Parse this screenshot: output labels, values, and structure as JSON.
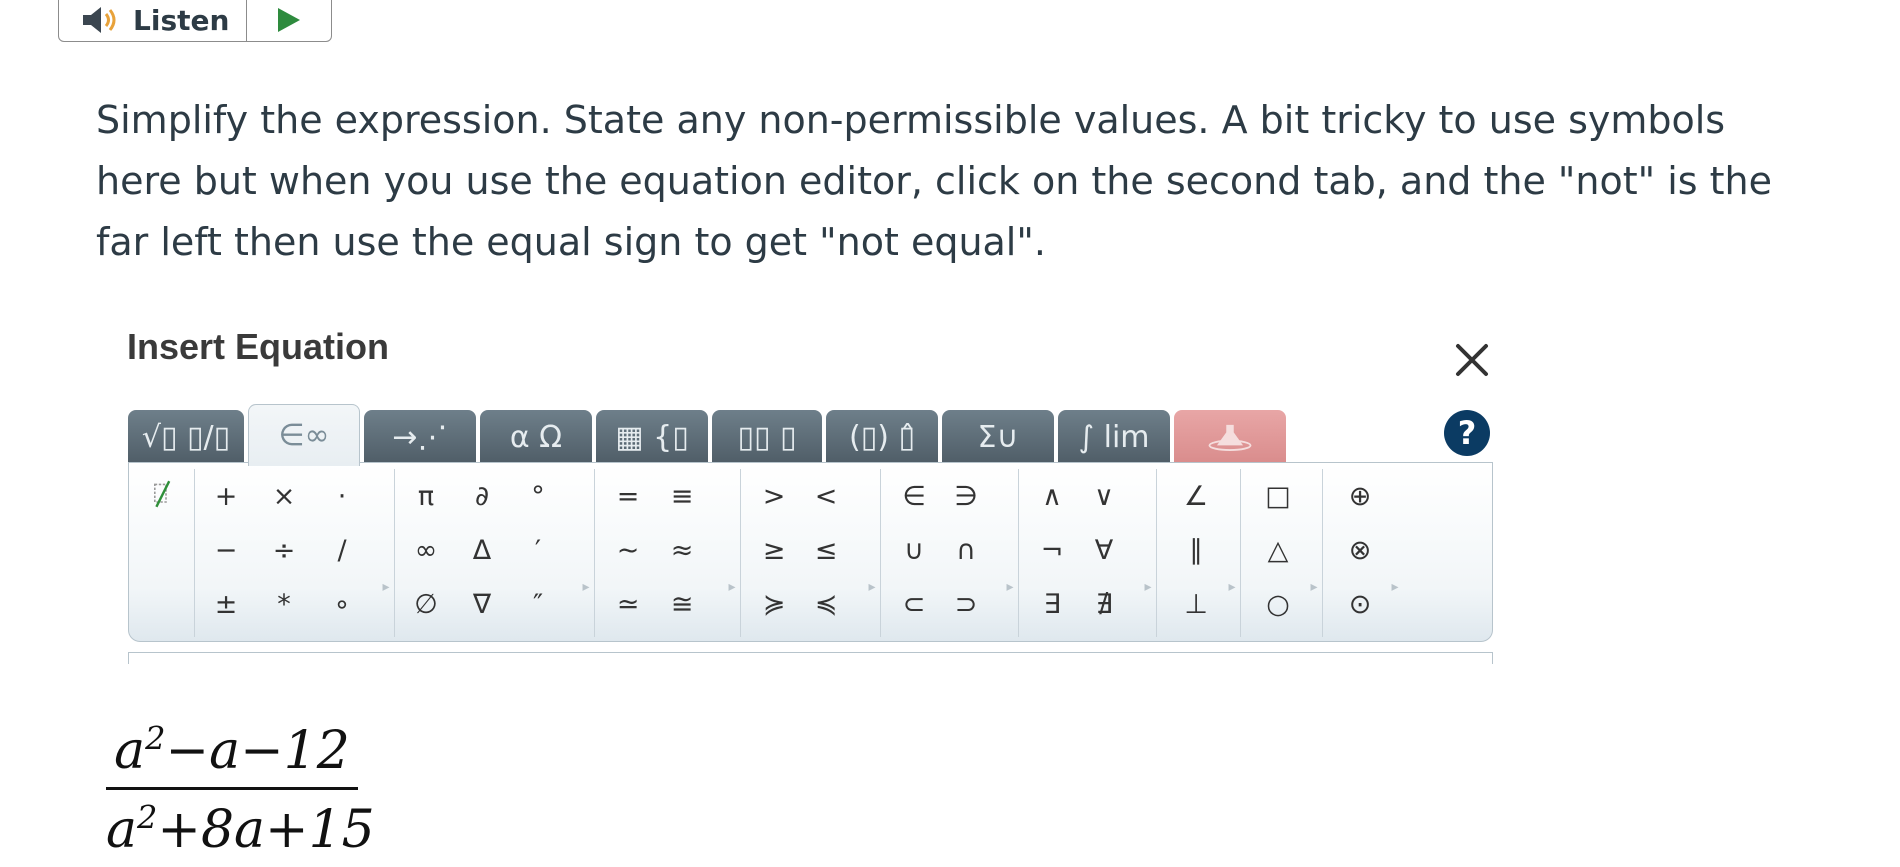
{
  "listen": {
    "label": "Listen"
  },
  "prompt": "Simplify the expression. State any non-permissible values. A bit tricky to use symbols here but when you use the equation editor, click on the second tab, and the \"not\" is the far left then use the equal sign to get \"not equal\".",
  "dialog": {
    "title": "Insert Equation",
    "tabs": [
      {
        "label": "√▯ ▯/▯"
      },
      {
        "label": "∈∞"
      },
      {
        "label": "→⋰"
      },
      {
        "label": "α Ω"
      },
      {
        "label": "▦ {▯"
      },
      {
        "label": "▯▯ ▯"
      },
      {
        "label": "(▯) ▯̂"
      },
      {
        "label": "Σ∪"
      },
      {
        "label": "∫ lim"
      },
      {
        "label": ""
      }
    ],
    "help": "?",
    "palette_groups": [
      {
        "symbols": [
          "̸"
        ]
      },
      {
        "symbols": [
          "+",
          "×",
          "·",
          "−",
          "÷",
          "/",
          "±",
          "*",
          "∘"
        ]
      },
      {
        "symbols": [
          "π",
          "∂",
          "°",
          "∞",
          "Δ",
          "′",
          "∅",
          "∇",
          "″"
        ]
      },
      {
        "symbols": [
          "=",
          "≡",
          "∼",
          "≈",
          "≃",
          "≅"
        ]
      },
      {
        "symbols": [
          ">",
          "<",
          "≥",
          "≤",
          "≽",
          "≼"
        ]
      },
      {
        "symbols": [
          "∈",
          "∋",
          "∪",
          "∩",
          "⊂",
          "⊃"
        ]
      },
      {
        "symbols": [
          "∧",
          "∨",
          "¬",
          "∀",
          "∃",
          "∄"
        ]
      },
      {
        "symbols": [
          "∠",
          "∥",
          "⊥"
        ]
      },
      {
        "symbols": [
          "□",
          "△",
          "○"
        ]
      },
      {
        "symbols": [
          "⊕",
          "⊗",
          "⊙"
        ]
      }
    ]
  },
  "expression": {
    "numerator": "a2−a−12",
    "denominator": "a2+8a+15"
  }
}
